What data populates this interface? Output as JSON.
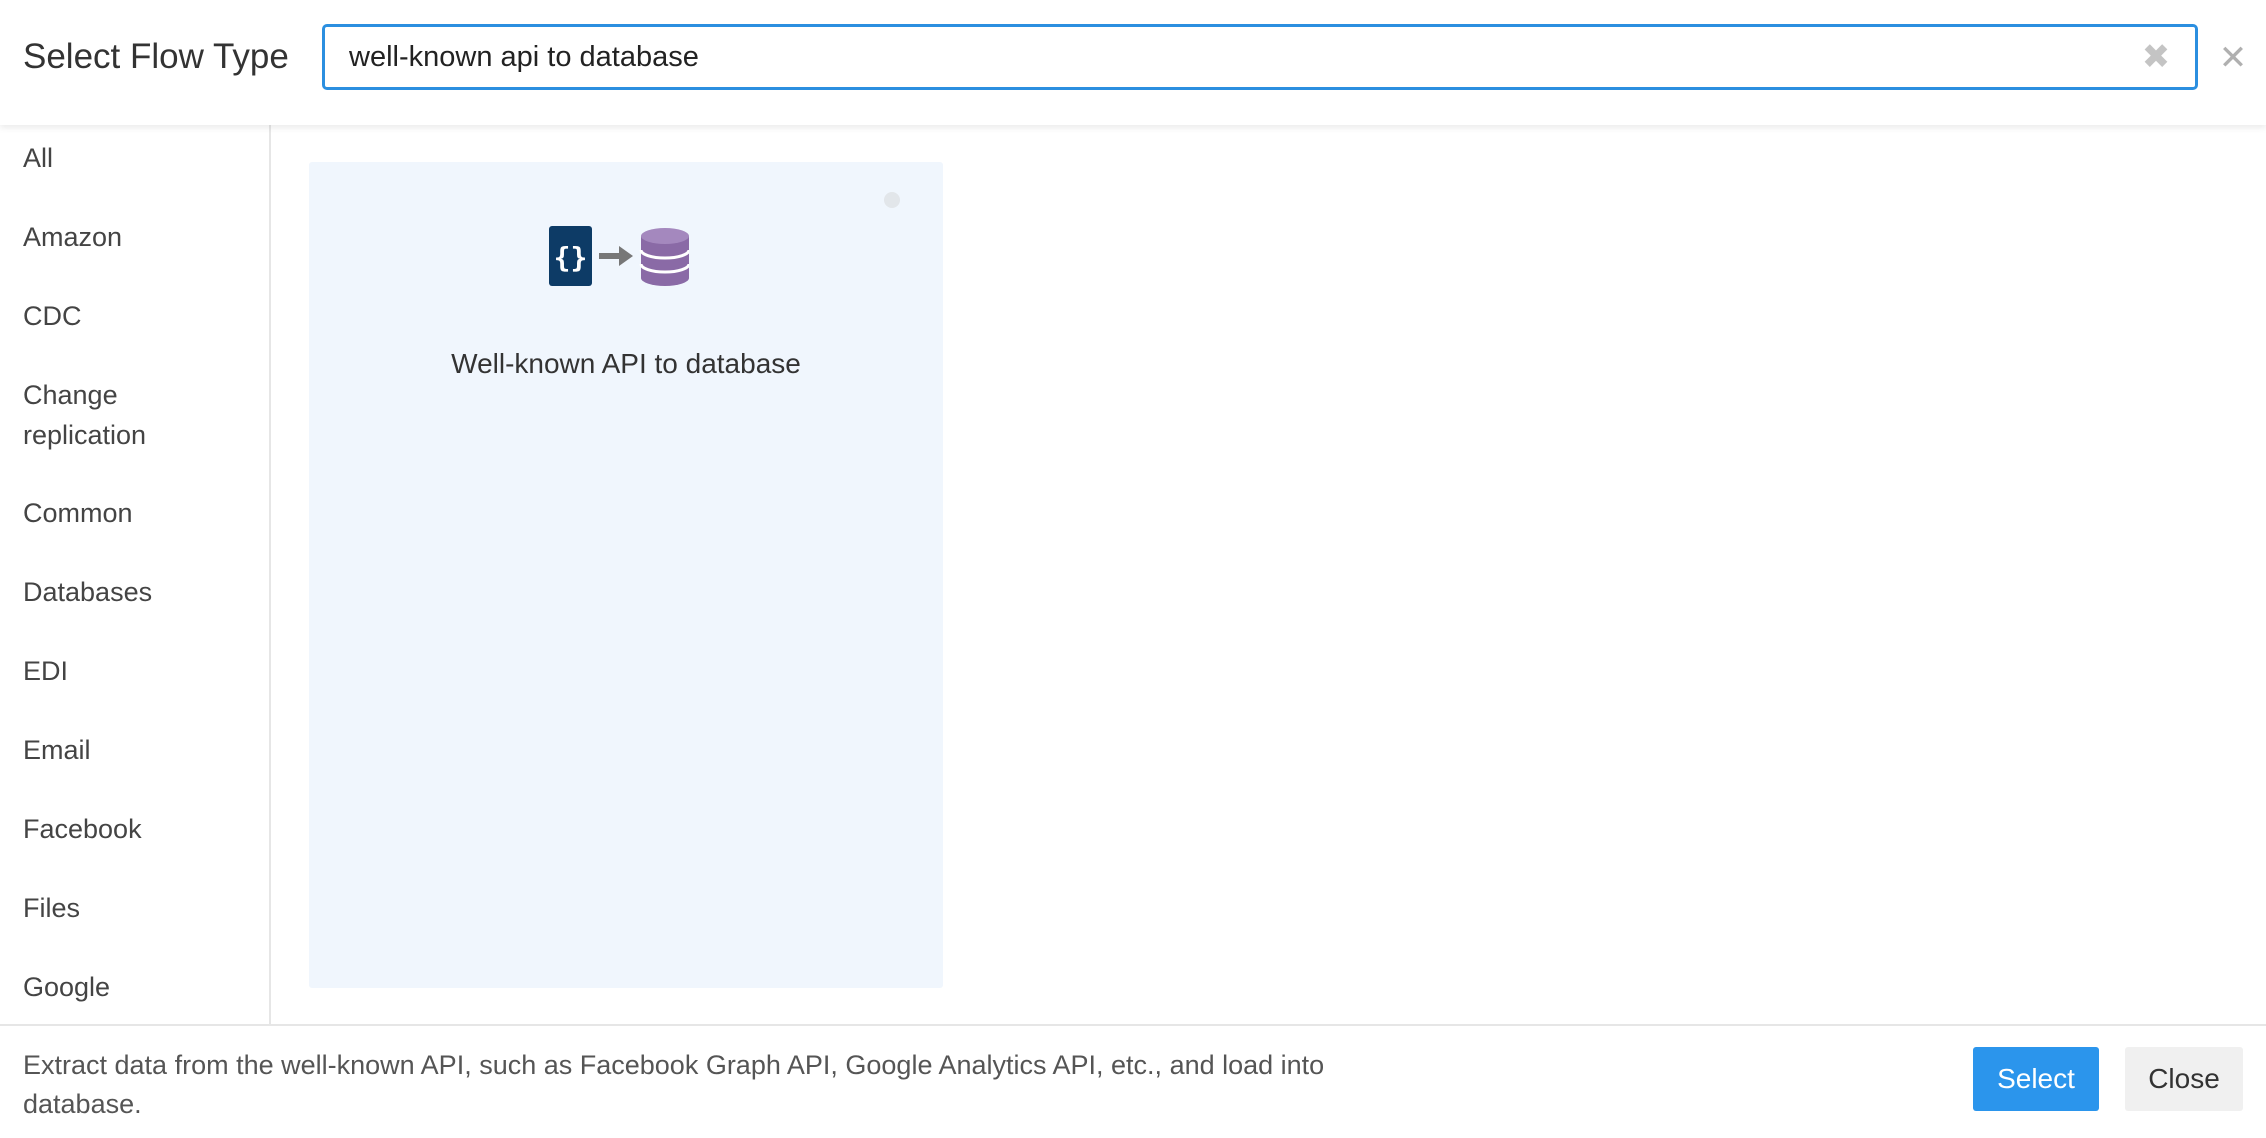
{
  "header": {
    "title": "Select Flow Type",
    "search_value": "well-known api to database",
    "clear_icon": "✖",
    "close_icon": "✕"
  },
  "sidebar": {
    "items": [
      {
        "label": "All"
      },
      {
        "label": "Amazon"
      },
      {
        "label": "CDC"
      },
      {
        "label": "Change replication"
      },
      {
        "label": "Common"
      },
      {
        "label": "Databases"
      },
      {
        "label": "EDI"
      },
      {
        "label": "Email"
      },
      {
        "label": "Facebook"
      },
      {
        "label": "Files"
      },
      {
        "label": "Google"
      }
    ]
  },
  "results": [
    {
      "title": "Well-known API to database",
      "icon": "api-to-database-icon"
    }
  ],
  "footer": {
    "description": "Extract data from the well-known API, such as Facebook Graph API, Google Analytics API, etc., and load into database.",
    "select_label": "Select",
    "close_label": "Close"
  },
  "colors": {
    "accent": "#2b95ec",
    "card_bg": "#f0f6fd",
    "api_icon": "#0d3b66",
    "db_icon": "#8a6aa6"
  }
}
